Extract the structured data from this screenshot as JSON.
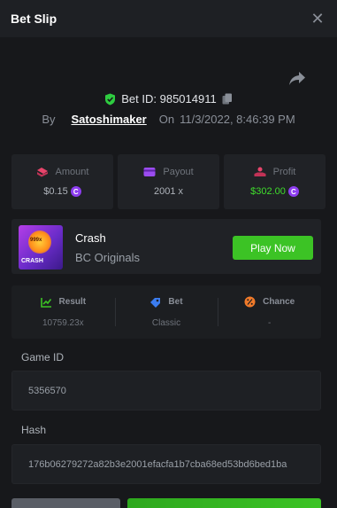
{
  "header": {
    "title": "Bet Slip",
    "close_glyph": "✕"
  },
  "bet": {
    "id_label": "Bet ID: 985014911",
    "by_label": "By",
    "user": "Satoshimaker",
    "on_label": "On",
    "date": "11/3/2022, 8:46:39 PM"
  },
  "stats": [
    {
      "label": "Amount",
      "value": "$0.15",
      "icon": "amount-icon",
      "coin": true,
      "value_color": "#aeb3ba"
    },
    {
      "label": "Payout",
      "value": "2001 x",
      "icon": "payout-icon",
      "coin": false,
      "value_color": "#aeb3ba"
    },
    {
      "label": "Profit",
      "value": "$302.00",
      "icon": "profit-icon",
      "coin": true,
      "value_color": "#3fdc2c"
    }
  ],
  "game": {
    "thumb_badge": "999x",
    "thumb_label": "CRASH",
    "name": "Crash",
    "provider": "BC Originals",
    "play_label": "Play Now"
  },
  "result": [
    {
      "label": "Result",
      "value": "10759.23x",
      "icon": "result-icon"
    },
    {
      "label": "Bet",
      "value": "Classic",
      "icon": "bet-icon"
    },
    {
      "label": "Chance",
      "value": "-",
      "icon": "chance-icon"
    }
  ],
  "fields": {
    "game_id_label": "Game ID",
    "game_id_value": "5356570",
    "hash_label": "Hash",
    "hash_value": "176b06279272a82b3e2001efacfa1b7cba68ed53bd6bed1ba"
  },
  "colors": {
    "accent_green": "#3cc325",
    "profit_green": "#3fdc2c",
    "coin_purple": "#8d3df0",
    "background": "#17181b"
  }
}
